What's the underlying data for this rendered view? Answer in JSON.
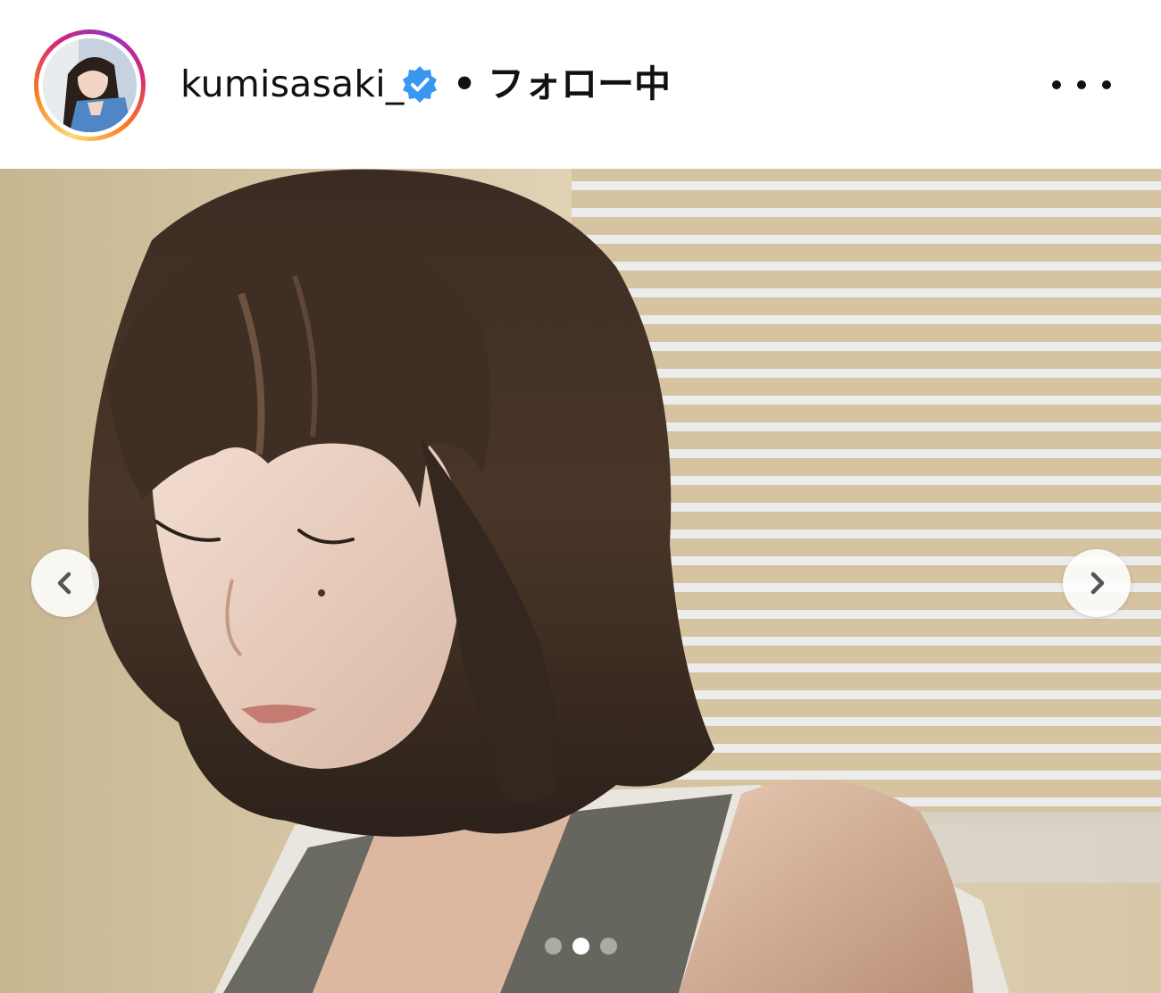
{
  "post": {
    "username": "kumisasaki_",
    "separator": "•",
    "follow_status": "フォロー中"
  },
  "icons": {
    "verified": "verified-badge-icon",
    "more": "more-options-icon",
    "prev": "chevron-left-icon",
    "next": "chevron-right-icon"
  },
  "colors": {
    "verified_blue": "#3897f0",
    "text": "#111111"
  },
  "carousel": {
    "total_slides": 3,
    "current_slide": 2
  }
}
